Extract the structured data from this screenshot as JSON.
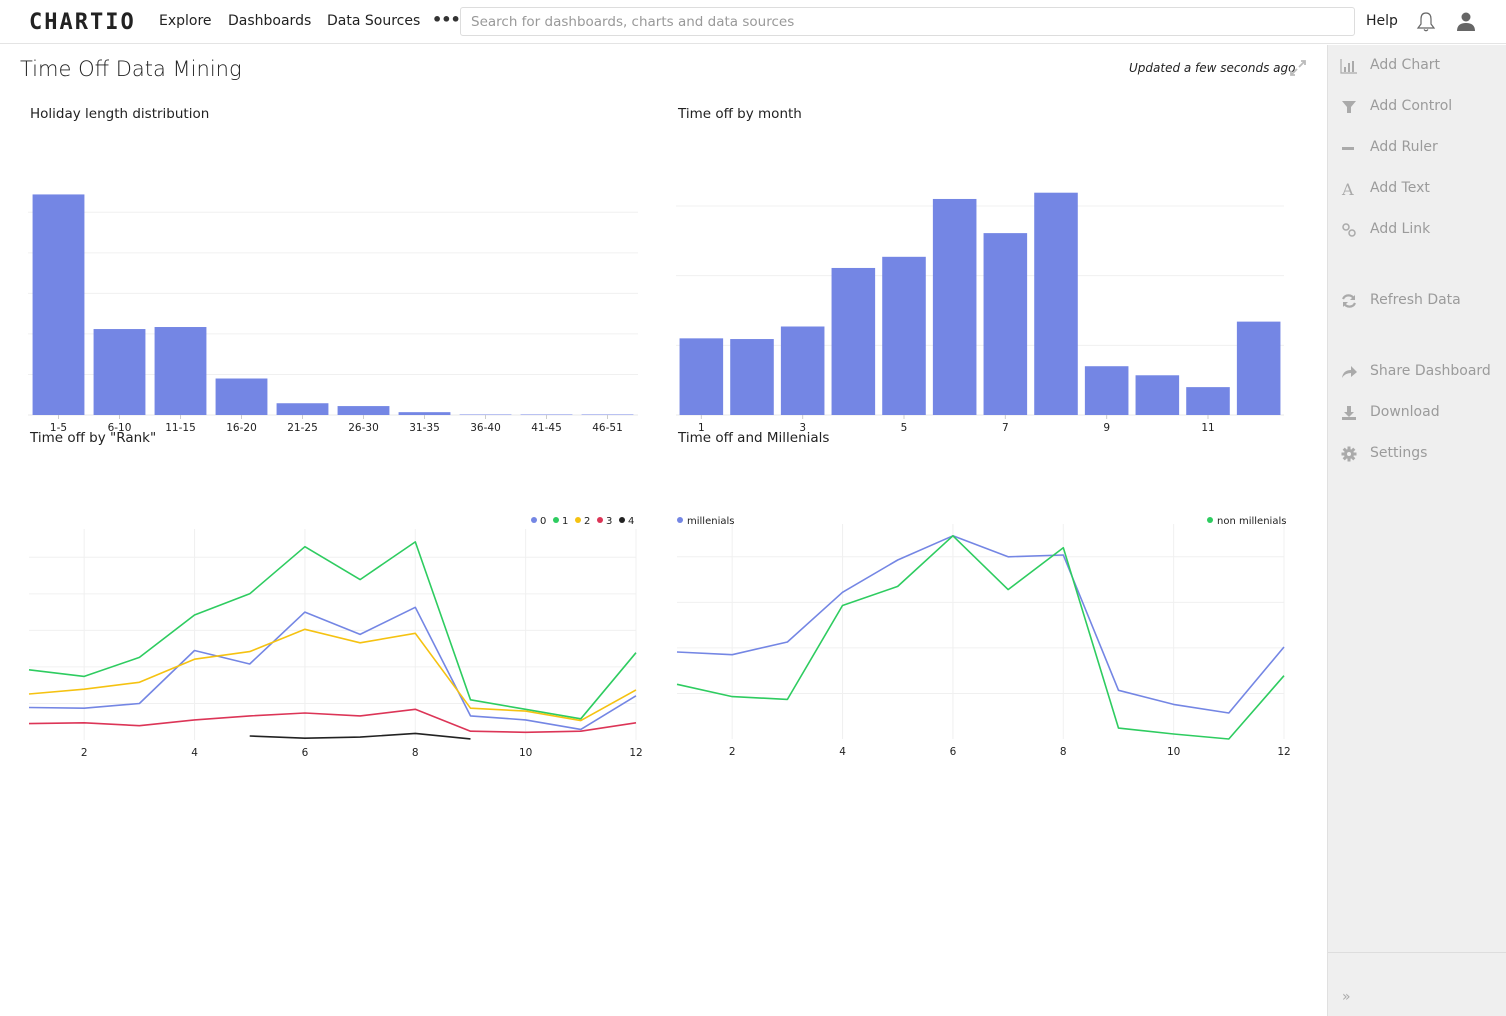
{
  "app": {
    "logo": "CHARTIO",
    "nav": [
      {
        "label": "Explore"
      },
      {
        "label": "Dashboards"
      },
      {
        "label": "Data Sources"
      }
    ],
    "more_icon": "ellipsis-icon",
    "search_placeholder": "Search for dashboards, charts and data sources",
    "help_label": "Help",
    "bell_icon": "bell-icon",
    "user_icon": "user-icon"
  },
  "dashboard": {
    "title": "Time Off Data Mining",
    "updated": "Updated a few seconds ago",
    "expand_icon": "expand-icon"
  },
  "sidebar": {
    "items": [
      {
        "label": "Add Chart",
        "icon": "bar-chart-icon"
      },
      {
        "label": "Add Control",
        "icon": "filter-icon"
      },
      {
        "label": "Add Ruler",
        "icon": "minus-icon"
      },
      {
        "label": "Add Text",
        "icon": "text-icon"
      },
      {
        "label": "Add Link",
        "icon": "link-icon"
      },
      {
        "label": "Refresh Data",
        "icon": "refresh-icon"
      },
      {
        "label": "Share Dashboard",
        "icon": "share-icon"
      },
      {
        "label": "Download",
        "icon": "download-icon"
      },
      {
        "label": "Settings",
        "icon": "gear-icon"
      }
    ],
    "collapse_icon": "double-chevron-right-icon"
  },
  "colors": {
    "bar": "#7486e4",
    "grid": "#f0f0f0",
    "series": [
      "#7486e4",
      "#2ecc60",
      "#f5c211",
      "#dc3557",
      "#222222"
    ]
  },
  "chart_data": [
    {
      "type": "bar",
      "title": "Holiday length distribution",
      "categories": [
        "1-5",
        "6-10",
        "11-15",
        "16-20",
        "21-25",
        "26-30",
        "31-35",
        "36-40",
        "41-45",
        "46-51"
      ],
      "values": [
        5.44,
        2.12,
        2.17,
        0.9,
        0.29,
        0.22,
        0.07,
        0.01,
        0.01,
        0.01
      ],
      "ylim": [
        0,
        5.5
      ],
      "grid": true,
      "xlabel": "",
      "ylabel": "",
      "y_tick_labels_visible": false
    },
    {
      "type": "bar",
      "title": "Time off by month",
      "categories": [
        "1",
        "2",
        "3",
        "4",
        "5",
        "6",
        "7",
        "8",
        "9",
        "10",
        "11",
        "12"
      ],
      "x_tick_labels": [
        "1",
        "3",
        "5",
        "7",
        "9",
        "11"
      ],
      "values": [
        1.1,
        1.09,
        1.27,
        2.11,
        2.27,
        3.1,
        2.61,
        3.19,
        0.7,
        0.57,
        0.4,
        1.34
      ],
      "ylim": [
        0,
        3.2
      ],
      "grid": true,
      "xlabel": "",
      "ylabel": "",
      "y_tick_labels_visible": false
    },
    {
      "type": "line",
      "title": "Time off by \"Rank\"",
      "x": [
        1,
        2,
        3,
        4,
        5,
        6,
        7,
        8,
        9,
        10,
        11,
        12
      ],
      "x_tick_labels": [
        "2",
        "4",
        "6",
        "8",
        "10",
        "12"
      ],
      "legend": "top-right",
      "series": [
        {
          "name": "0",
          "values": [
            0.89,
            0.87,
            1.0,
            2.45,
            2.08,
            3.5,
            2.89,
            3.63,
            0.66,
            0.55,
            0.29,
            1.21
          ]
        },
        {
          "name": "1",
          "values": [
            1.92,
            1.74,
            2.26,
            3.42,
            4.0,
            5.29,
            4.39,
            5.42,
            1.1,
            0.84,
            0.58,
            2.39
          ]
        },
        {
          "name": "2",
          "values": [
            1.26,
            1.39,
            1.58,
            2.21,
            2.42,
            3.03,
            2.66,
            2.92,
            0.87,
            0.79,
            0.53,
            1.37
          ]
        },
        {
          "name": "3",
          "values": [
            0.45,
            0.47,
            0.39,
            0.55,
            0.66,
            0.74,
            0.66,
            0.84,
            0.24,
            0.21,
            0.24,
            0.47
          ]
        },
        {
          "name": "4",
          "values": [
            null,
            null,
            null,
            null,
            0.11,
            0.05,
            0.08,
            0.18,
            0.03,
            null,
            null,
            null
          ]
        }
      ],
      "ylim": [
        0,
        5.5
      ],
      "grid": true,
      "y_tick_labels_visible": false
    },
    {
      "type": "line",
      "title": "Time off and Millenials",
      "x": [
        1,
        2,
        3,
        4,
        5,
        6,
        7,
        8,
        9,
        10,
        11,
        12
      ],
      "x_tick_labels": [
        "2",
        "4",
        "6",
        "8",
        "10",
        "12"
      ],
      "legend": "top, split left/right",
      "series": [
        {
          "name": "millenials",
          "values": [
            1.91,
            1.85,
            2.13,
            3.22,
            3.93,
            4.46,
            4.0,
            4.04,
            1.07,
            0.76,
            0.57,
            2.02
          ]
        },
        {
          "name": "non millenials",
          "values": [
            1.2,
            0.93,
            0.87,
            2.93,
            3.35,
            4.46,
            3.28,
            4.2,
            0.24,
            0.11,
            0.0,
            1.39
          ]
        }
      ],
      "ylim": [
        0,
        4.5
      ],
      "grid": true,
      "y_tick_labels_visible": false
    }
  ]
}
